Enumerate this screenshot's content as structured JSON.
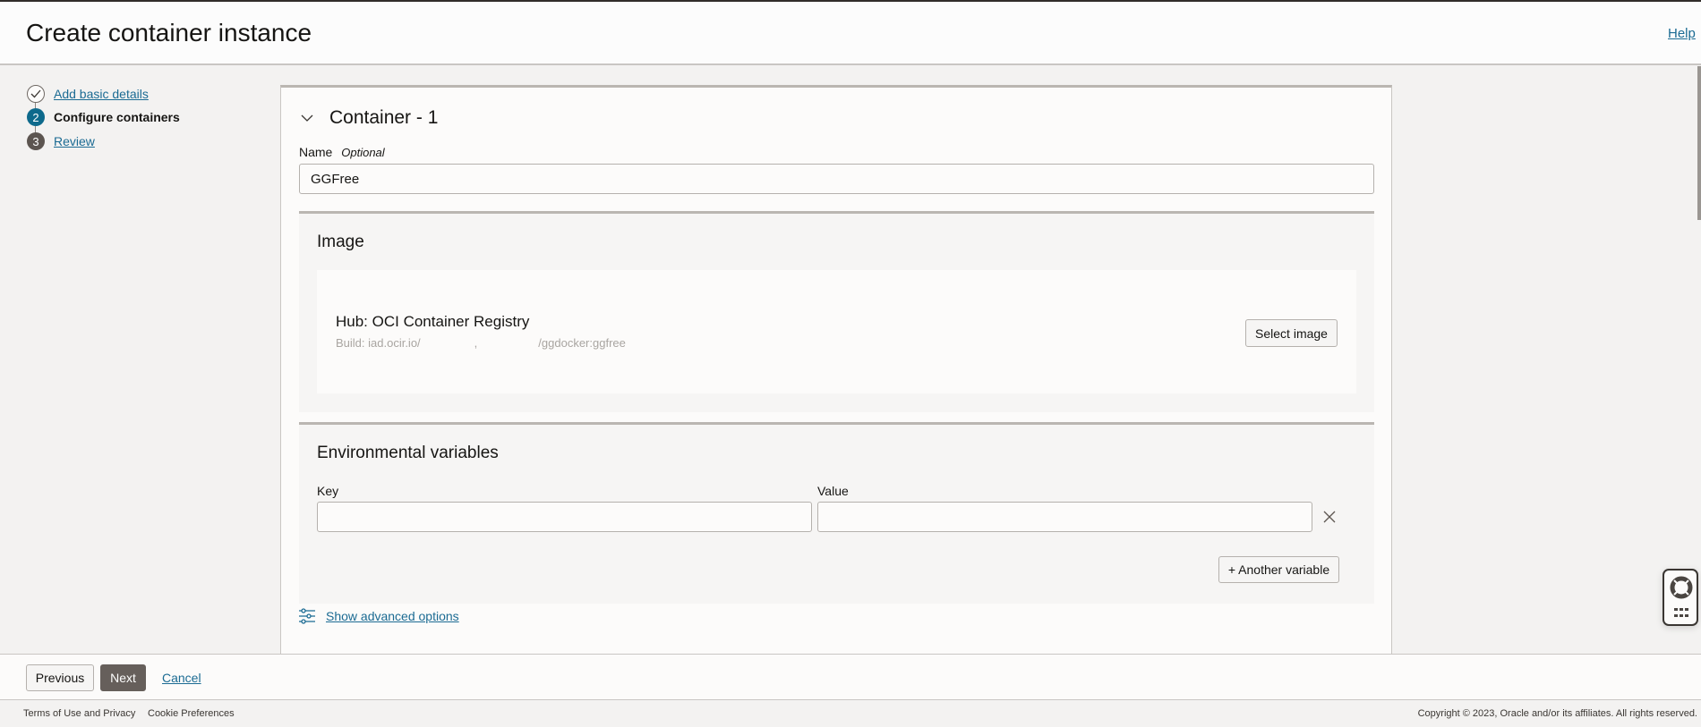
{
  "header": {
    "title": "Create container instance",
    "help": "Help"
  },
  "steps": [
    {
      "number": "1",
      "label": "Add basic details",
      "state": "done"
    },
    {
      "number": "2",
      "label": "Configure containers",
      "state": "current"
    },
    {
      "number": "3",
      "label": "Review",
      "state": "pending"
    }
  ],
  "container": {
    "title": "Container - 1",
    "name_label": "Name",
    "name_optional": "Optional",
    "name_value": "GGFree",
    "image": {
      "heading": "Image",
      "hub": "Hub: OCI Container Registry",
      "build_prefix": "Build: iad.ocir.io/",
      "build_sep": ",",
      "build_suffix": "/ggdocker:ggfree",
      "select_button": "Select image"
    },
    "env": {
      "heading": "Environmental variables",
      "key_label": "Key",
      "value_label": "Value",
      "key_value": "",
      "value_value": "",
      "add_button": "+ Another variable"
    },
    "advanced_link": "Show advanced options"
  },
  "actions": {
    "previous": "Previous",
    "next": "Next",
    "cancel": "Cancel"
  },
  "footer": {
    "terms": "Terms of Use and Privacy",
    "cookies": "Cookie Preferences",
    "copyright": "Copyright © 2023, Oracle and/or its affiliates. All rights reserved."
  },
  "colors": {
    "accent": "#1b6b93",
    "current_step": "#0e6a8c",
    "next_button": "#665f5b"
  }
}
